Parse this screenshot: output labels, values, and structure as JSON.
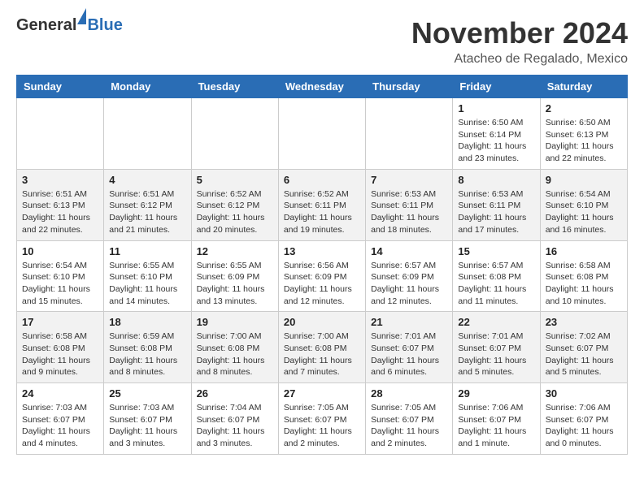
{
  "logo": {
    "general": "General",
    "blue": "Blue"
  },
  "header": {
    "month": "November 2024",
    "location": "Atacheo de Regalado, Mexico"
  },
  "weekdays": [
    "Sunday",
    "Monday",
    "Tuesday",
    "Wednesday",
    "Thursday",
    "Friday",
    "Saturday"
  ],
  "weeks": [
    [
      {
        "day": "",
        "info": ""
      },
      {
        "day": "",
        "info": ""
      },
      {
        "day": "",
        "info": ""
      },
      {
        "day": "",
        "info": ""
      },
      {
        "day": "",
        "info": ""
      },
      {
        "day": "1",
        "info": "Sunrise: 6:50 AM\nSunset: 6:14 PM\nDaylight: 11 hours and 23 minutes."
      },
      {
        "day": "2",
        "info": "Sunrise: 6:50 AM\nSunset: 6:13 PM\nDaylight: 11 hours and 22 minutes."
      }
    ],
    [
      {
        "day": "3",
        "info": "Sunrise: 6:51 AM\nSunset: 6:13 PM\nDaylight: 11 hours and 22 minutes."
      },
      {
        "day": "4",
        "info": "Sunrise: 6:51 AM\nSunset: 6:12 PM\nDaylight: 11 hours and 21 minutes."
      },
      {
        "day": "5",
        "info": "Sunrise: 6:52 AM\nSunset: 6:12 PM\nDaylight: 11 hours and 20 minutes."
      },
      {
        "day": "6",
        "info": "Sunrise: 6:52 AM\nSunset: 6:11 PM\nDaylight: 11 hours and 19 minutes."
      },
      {
        "day": "7",
        "info": "Sunrise: 6:53 AM\nSunset: 6:11 PM\nDaylight: 11 hours and 18 minutes."
      },
      {
        "day": "8",
        "info": "Sunrise: 6:53 AM\nSunset: 6:11 PM\nDaylight: 11 hours and 17 minutes."
      },
      {
        "day": "9",
        "info": "Sunrise: 6:54 AM\nSunset: 6:10 PM\nDaylight: 11 hours and 16 minutes."
      }
    ],
    [
      {
        "day": "10",
        "info": "Sunrise: 6:54 AM\nSunset: 6:10 PM\nDaylight: 11 hours and 15 minutes."
      },
      {
        "day": "11",
        "info": "Sunrise: 6:55 AM\nSunset: 6:10 PM\nDaylight: 11 hours and 14 minutes."
      },
      {
        "day": "12",
        "info": "Sunrise: 6:55 AM\nSunset: 6:09 PM\nDaylight: 11 hours and 13 minutes."
      },
      {
        "day": "13",
        "info": "Sunrise: 6:56 AM\nSunset: 6:09 PM\nDaylight: 11 hours and 12 minutes."
      },
      {
        "day": "14",
        "info": "Sunrise: 6:57 AM\nSunset: 6:09 PM\nDaylight: 11 hours and 12 minutes."
      },
      {
        "day": "15",
        "info": "Sunrise: 6:57 AM\nSunset: 6:08 PM\nDaylight: 11 hours and 11 minutes."
      },
      {
        "day": "16",
        "info": "Sunrise: 6:58 AM\nSunset: 6:08 PM\nDaylight: 11 hours and 10 minutes."
      }
    ],
    [
      {
        "day": "17",
        "info": "Sunrise: 6:58 AM\nSunset: 6:08 PM\nDaylight: 11 hours and 9 minutes."
      },
      {
        "day": "18",
        "info": "Sunrise: 6:59 AM\nSunset: 6:08 PM\nDaylight: 11 hours and 8 minutes."
      },
      {
        "day": "19",
        "info": "Sunrise: 7:00 AM\nSunset: 6:08 PM\nDaylight: 11 hours and 8 minutes."
      },
      {
        "day": "20",
        "info": "Sunrise: 7:00 AM\nSunset: 6:08 PM\nDaylight: 11 hours and 7 minutes."
      },
      {
        "day": "21",
        "info": "Sunrise: 7:01 AM\nSunset: 6:07 PM\nDaylight: 11 hours and 6 minutes."
      },
      {
        "day": "22",
        "info": "Sunrise: 7:01 AM\nSunset: 6:07 PM\nDaylight: 11 hours and 5 minutes."
      },
      {
        "day": "23",
        "info": "Sunrise: 7:02 AM\nSunset: 6:07 PM\nDaylight: 11 hours and 5 minutes."
      }
    ],
    [
      {
        "day": "24",
        "info": "Sunrise: 7:03 AM\nSunset: 6:07 PM\nDaylight: 11 hours and 4 minutes."
      },
      {
        "day": "25",
        "info": "Sunrise: 7:03 AM\nSunset: 6:07 PM\nDaylight: 11 hours and 3 minutes."
      },
      {
        "day": "26",
        "info": "Sunrise: 7:04 AM\nSunset: 6:07 PM\nDaylight: 11 hours and 3 minutes."
      },
      {
        "day": "27",
        "info": "Sunrise: 7:05 AM\nSunset: 6:07 PM\nDaylight: 11 hours and 2 minutes."
      },
      {
        "day": "28",
        "info": "Sunrise: 7:05 AM\nSunset: 6:07 PM\nDaylight: 11 hours and 2 minutes."
      },
      {
        "day": "29",
        "info": "Sunrise: 7:06 AM\nSunset: 6:07 PM\nDaylight: 11 hours and 1 minute."
      },
      {
        "day": "30",
        "info": "Sunrise: 7:06 AM\nSunset: 6:07 PM\nDaylight: 11 hours and 0 minutes."
      }
    ]
  ]
}
